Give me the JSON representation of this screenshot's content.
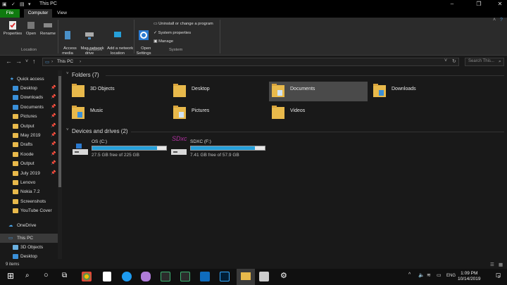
{
  "window": {
    "title": "This PC"
  },
  "tabs": {
    "file": "File",
    "computer": "Computer",
    "view": "View"
  },
  "ribbon": {
    "properties": "Properties",
    "open": "Open",
    "rename": "Rename",
    "access_media": "Access\nmedia",
    "map_drive": "Map network\ndrive",
    "add_location": "Add a network\nlocation",
    "open_settings": "Open\nSettings",
    "uninstall": "Uninstall or change a program",
    "system_properties": "System properties",
    "manage": "Manage",
    "group_location": "Location",
    "group_network": "Network",
    "group_system": "System"
  },
  "address": {
    "path": "This PC",
    "search_placeholder": "Search This..."
  },
  "nav": {
    "quick_access": "Quick access",
    "items": [
      "Desktop",
      "Downloads",
      "Documents",
      "Pictures",
      "Output",
      "May 2019",
      "Drafts",
      "Koode",
      "Output",
      "July 2019",
      "Lenovo",
      "Nokia 7.2",
      "Screenshots",
      "YouTube Cover"
    ],
    "onedrive": "OneDrive",
    "this_pc": "This PC",
    "sub": [
      "3D Objects",
      "Desktop"
    ]
  },
  "folders": {
    "heading": "Folders (7)",
    "items": [
      "3D Objects",
      "Desktop",
      "Documents",
      "Downloads",
      "Music",
      "Pictures",
      "Videos"
    ]
  },
  "drives": {
    "heading": "Devices and drives (2)",
    "items": [
      {
        "name": "OS (C:)",
        "space": "27.5 GB free of 225 GB",
        "used_pct": 88,
        "logo": ""
      },
      {
        "name": "SDXC (F:)",
        "space": "7.41 GB free of 57.9 GB",
        "used_pct": 87,
        "logo": "SDxc"
      }
    ]
  },
  "status": {
    "count": "9 items"
  },
  "clock": {
    "time": "1:09 PM",
    "date": "10/14/2019",
    "lang": "ENG",
    "notif": "3"
  },
  "colors": {
    "accent_file": "#0f7a0f",
    "folder": "#e8b94b",
    "drive_fill": "#26a0da",
    "selected": "#4a4a4a"
  }
}
